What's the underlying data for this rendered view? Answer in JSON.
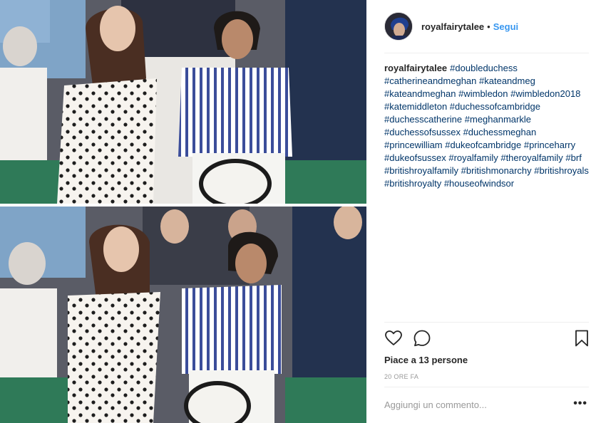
{
  "post": {
    "author": "royalfairytalee",
    "separator": "•",
    "follow_label": "Segui",
    "caption_user": "royalfairytalee",
    "hashtags": [
      "#doubleduchess",
      "#catherineandmeghan",
      "#kateandmeg",
      "#kateandmeghan",
      "#wimbledon",
      "#wimbledon2018",
      "#katemiddleton",
      "#duchessofcambridge",
      "#duchesscatherine",
      "#meghanmarkle",
      "#duchessofsussex",
      "#duchessmeghan",
      "#princewilliam",
      "#dukeofcambridge",
      "#princeharry",
      "#dukeofsussex",
      "#royalfamily",
      "#theroyalfamily",
      "#brf",
      "#britishroyalfamily",
      "#britishmonarchy",
      "#britishroyals",
      "#britishroyalty",
      "#houseofwindsor"
    ],
    "likes_text": "Piace a 13 persone",
    "time_text": "20 ORE FA",
    "comment_placeholder": "Aggiungi un commento...",
    "more_label": "•••"
  },
  "icons": {
    "like": "heart-icon",
    "comment": "comment-icon",
    "save": "bookmark-icon",
    "more": "more-options-icon"
  },
  "colors": {
    "link": "#3897f0",
    "hashtag": "#003569",
    "text": "#262626",
    "muted": "#999999",
    "divider": "#efefef"
  }
}
